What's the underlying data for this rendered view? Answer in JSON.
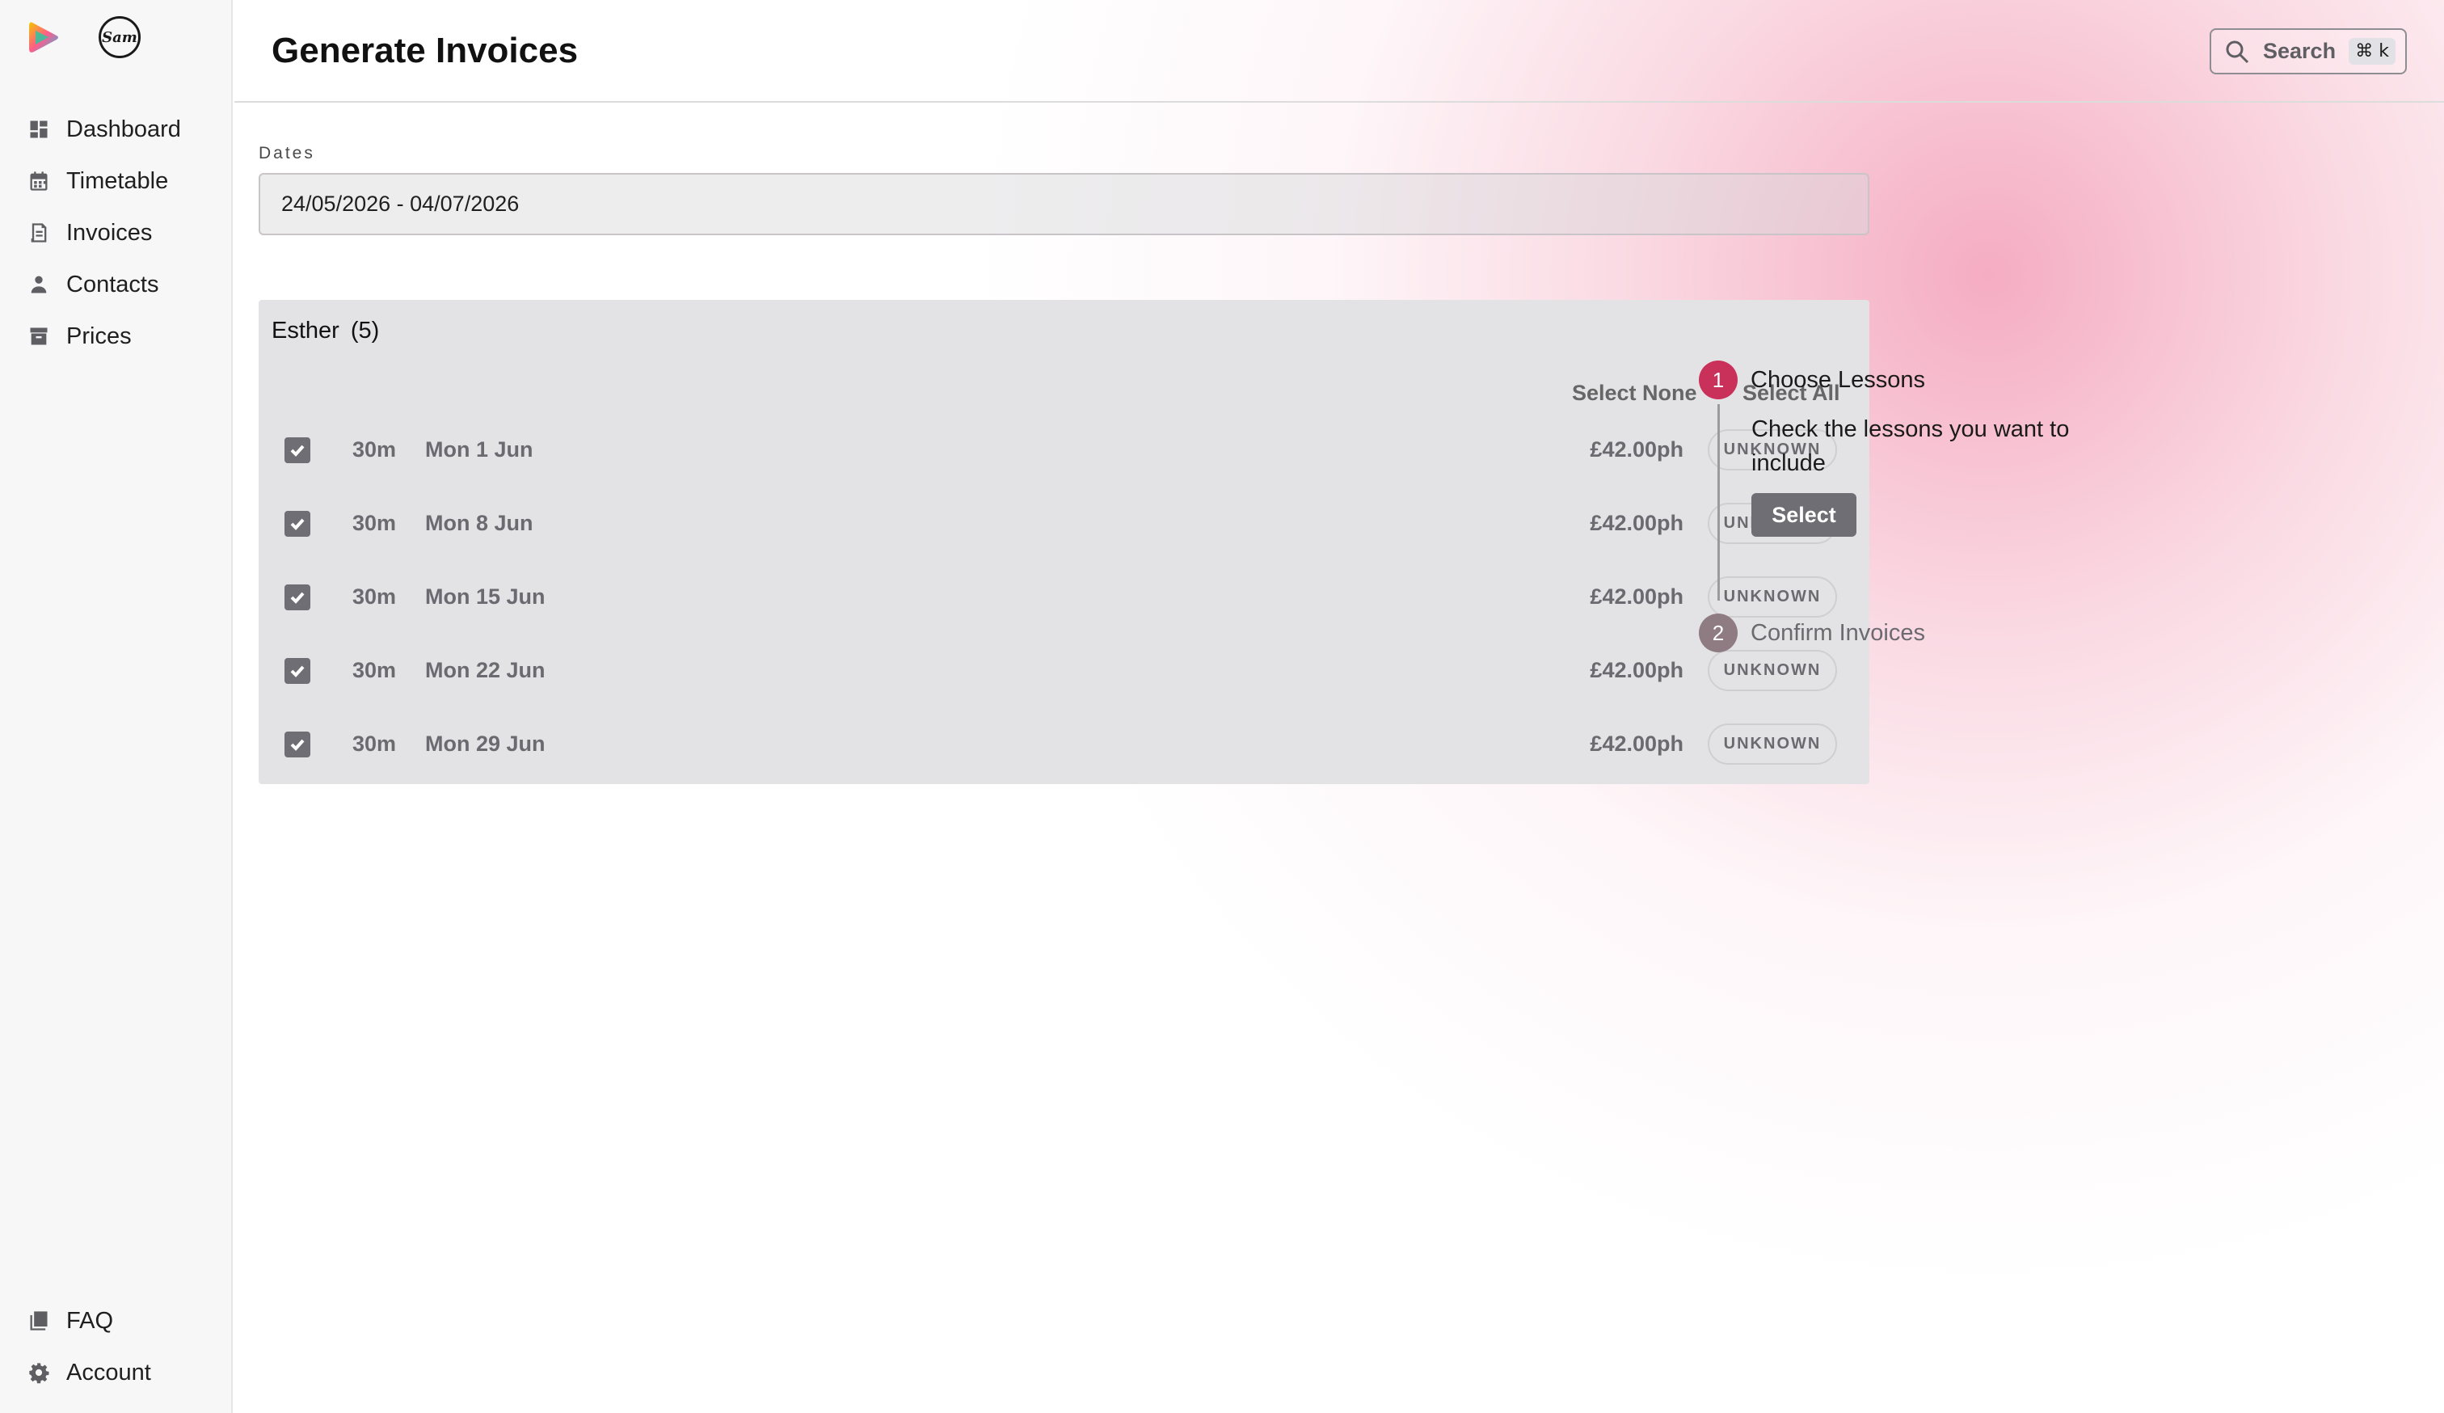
{
  "sidebar": {
    "brand_signature": "Sam",
    "nav": [
      {
        "label": "Dashboard",
        "icon": "dashboard-icon"
      },
      {
        "label": "Timetable",
        "icon": "calendar-icon"
      },
      {
        "label": "Invoices",
        "icon": "invoice-icon"
      },
      {
        "label": "Contacts",
        "icon": "person-icon"
      },
      {
        "label": "Prices",
        "icon": "archive-icon"
      }
    ],
    "footer": [
      {
        "label": "FAQ",
        "icon": "help-book-icon"
      },
      {
        "label": "Account",
        "icon": "gear-icon"
      }
    ]
  },
  "header": {
    "title": "Generate Invoices",
    "search": {
      "label": "Search",
      "shortcut": "⌘ k"
    }
  },
  "dates": {
    "label": "Dates",
    "value": "24/05/2026 - 04/07/2026"
  },
  "group": {
    "name": "Esther",
    "count": "(5)",
    "select_none": "Select None",
    "select_all": "Select All",
    "lessons": [
      {
        "duration": "30m",
        "date": "Mon 1 Jun",
        "price": "£42.00ph",
        "status": "UNKNOWN",
        "checked": true
      },
      {
        "duration": "30m",
        "date": "Mon 8 Jun",
        "price": "£42.00ph",
        "status": "UNKNOWN",
        "checked": true
      },
      {
        "duration": "30m",
        "date": "Mon 15 Jun",
        "price": "£42.00ph",
        "status": "UNKNOWN",
        "checked": true
      },
      {
        "duration": "30m",
        "date": "Mon 22 Jun",
        "price": "£42.00ph",
        "status": "UNKNOWN",
        "checked": true
      },
      {
        "duration": "30m",
        "date": "Mon 29 Jun",
        "price": "£42.00ph",
        "status": "UNKNOWN",
        "checked": true
      }
    ]
  },
  "stepper": {
    "steps": [
      {
        "number": "1",
        "title": "Choose Lessons",
        "description": "Check the lessons you want to include",
        "button": "Select",
        "active": true
      },
      {
        "number": "2",
        "title": "Confirm Invoices",
        "active": false
      }
    ]
  },
  "colors": {
    "accent": "#c9305a",
    "inactive_step": "#8e7c82",
    "button": "#6e6e74",
    "gradient_pink": "#f39eb8"
  }
}
